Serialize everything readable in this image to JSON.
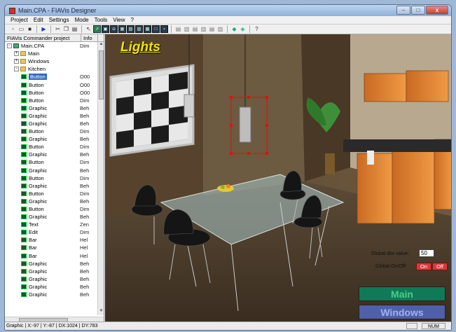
{
  "window": {
    "title": "Main.CPA - FIAVis Designer",
    "controls": [
      "–",
      "□",
      "x"
    ]
  },
  "menu": [
    "Project",
    "Edit",
    "Settings",
    "Mode",
    "Tools",
    "View",
    "?"
  ],
  "toolbar": {
    "icons": [
      "new-file-icon",
      "open-folder-icon",
      "save-icon",
      "run-icon",
      "cut-icon",
      "copy-icon",
      "paste-icon",
      "pointer-icon",
      "select-icon",
      "button-tool-icon",
      "graphic-tool-icon",
      "text-tool-icon",
      "edit-tool-icon",
      "bar-tool-icon",
      "panel-tool-icon",
      "frame-tool-icon",
      "check-tool-icon",
      "align-left-icon",
      "align-center-icon",
      "align-right-icon",
      "align-top-icon",
      "align-middle-icon",
      "align-bottom-icon",
      "plugin-icon",
      "transfer-icon",
      "help-icon"
    ]
  },
  "project_panel": {
    "col_project": "FIAVis Commander project",
    "col_info": "Info",
    "rows": [
      {
        "indent": 0,
        "type": "proj",
        "expander": "-",
        "name": "Main.CPA",
        "info": "Dim"
      },
      {
        "indent": 1,
        "type": "folder",
        "expander": "+",
        "name": "Main",
        "info": ""
      },
      {
        "indent": 1,
        "type": "folder",
        "expander": "+",
        "name": "Windows",
        "info": ""
      },
      {
        "indent": 1,
        "type": "folder",
        "expander": "-",
        "name": "Kitchen",
        "info": ""
      },
      {
        "indent": 2,
        "type": "item",
        "name": "Button",
        "info": "O00",
        "selected": true
      },
      {
        "indent": 2,
        "type": "item",
        "name": "Button",
        "info": "O00"
      },
      {
        "indent": 2,
        "type": "item",
        "name": "Button",
        "info": "O00"
      },
      {
        "indent": 2,
        "type": "item",
        "name": "Button",
        "info": "Dim"
      },
      {
        "indent": 2,
        "type": "item",
        "name": "Graphic",
        "info": "Beh"
      },
      {
        "indent": 2,
        "type": "item",
        "name": "Graphic",
        "info": "Beh"
      },
      {
        "indent": 2,
        "type": "item",
        "name": "Graphic",
        "info": "Beh"
      },
      {
        "indent": 2,
        "type": "item",
        "name": "Button",
        "info": "Dim"
      },
      {
        "indent": 2,
        "type": "item",
        "name": "Graphic",
        "info": "Beh"
      },
      {
        "indent": 2,
        "type": "item",
        "name": "Button",
        "info": "Dim"
      },
      {
        "indent": 2,
        "type": "item",
        "name": "Graphic",
        "info": "Beh"
      },
      {
        "indent": 2,
        "type": "item",
        "name": "Button",
        "info": "Dim"
      },
      {
        "indent": 2,
        "type": "item",
        "name": "Graphic",
        "info": "Beh"
      },
      {
        "indent": 2,
        "type": "item",
        "name": "Button",
        "info": "Dim"
      },
      {
        "indent": 2,
        "type": "item",
        "name": "Graphic",
        "info": "Beh"
      },
      {
        "indent": 2,
        "type": "item",
        "name": "Button",
        "info": "Dim"
      },
      {
        "indent": 2,
        "type": "item",
        "name": "Graphic",
        "info": "Beh"
      },
      {
        "indent": 2,
        "type": "item",
        "name": "Button",
        "info": "Dim"
      },
      {
        "indent": 2,
        "type": "item",
        "name": "Graphic",
        "info": "Beh"
      },
      {
        "indent": 2,
        "type": "item",
        "name": "Text",
        "info": "Zen"
      },
      {
        "indent": 2,
        "type": "item",
        "name": "Edit",
        "info": "Dim"
      },
      {
        "indent": 2,
        "type": "item",
        "name": "Bar",
        "info": "Hel"
      },
      {
        "indent": 2,
        "type": "item",
        "name": "Bar",
        "info": "Hel"
      },
      {
        "indent": 2,
        "type": "item",
        "name": "Bar",
        "info": "Hel"
      },
      {
        "indent": 2,
        "type": "item",
        "name": "Graphic",
        "info": "Beh"
      },
      {
        "indent": 2,
        "type": "item",
        "name": "Graphic",
        "info": "Beh"
      },
      {
        "indent": 2,
        "type": "item",
        "name": "Graphic",
        "info": "Beh"
      },
      {
        "indent": 2,
        "type": "item",
        "name": "Graphic",
        "info": "Beh"
      },
      {
        "indent": 2,
        "type": "item",
        "name": "Graphic",
        "info": "Beh"
      }
    ]
  },
  "canvas": {
    "title": "Lights",
    "global_dim_label": "Global dim value:",
    "global_dim_value": "50",
    "global_onoff_label": "Global On/Off:",
    "on_label": "On",
    "off_label": "Off",
    "main_button": "Main",
    "windows_button": "Windows"
  },
  "statusbar": {
    "text": "Graphic | X:-97 | Y:-87 | DX:1024 | DY:783",
    "num": "NUM"
  }
}
